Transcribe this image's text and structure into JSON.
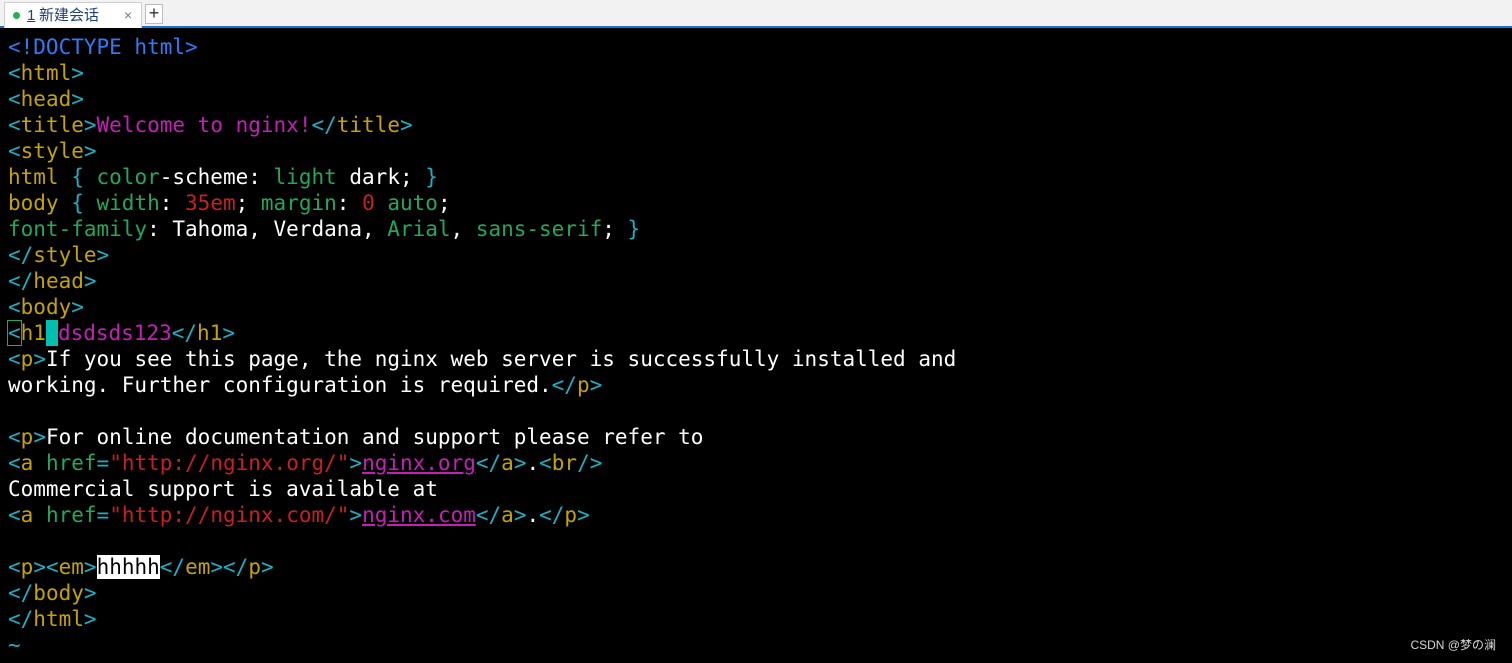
{
  "tab": {
    "number": "1",
    "title": "新建会话",
    "close_icon": "×",
    "new_tab_icon": "+",
    "status_color": "#22b14c"
  },
  "editor": {
    "lines": [
      [
        {
          "c": "b",
          "t": "<!DOCTYPE html>"
        }
      ],
      [
        {
          "c": "t",
          "t": "<"
        },
        {
          "c": "n",
          "t": "html"
        },
        {
          "c": "t",
          "t": ">"
        }
      ],
      [
        {
          "c": "t",
          "t": "<"
        },
        {
          "c": "n",
          "t": "head"
        },
        {
          "c": "t",
          "t": ">"
        }
      ],
      [
        {
          "c": "t",
          "t": "<"
        },
        {
          "c": "n",
          "t": "title"
        },
        {
          "c": "t",
          "t": ">"
        },
        {
          "c": "m",
          "t": "Welcome to nginx!"
        },
        {
          "c": "t",
          "t": "</"
        },
        {
          "c": "n",
          "t": "title"
        },
        {
          "c": "t",
          "t": ">"
        }
      ],
      [
        {
          "c": "t",
          "t": "<"
        },
        {
          "c": "n",
          "t": "style"
        },
        {
          "c": "t",
          "t": ">"
        }
      ],
      [
        {
          "c": "n",
          "t": "html "
        },
        {
          "c": "t",
          "t": "{ "
        },
        {
          "c": "k",
          "t": "color"
        },
        {
          "c": "w",
          "t": "-scheme: "
        },
        {
          "c": "k",
          "t": "light"
        },
        {
          "c": "w",
          "t": " dark; "
        },
        {
          "c": "t",
          "t": "}"
        }
      ],
      [
        {
          "c": "n",
          "t": "body "
        },
        {
          "c": "t",
          "t": "{ "
        },
        {
          "c": "k",
          "t": "width"
        },
        {
          "c": "w",
          "t": ": "
        },
        {
          "c": "v",
          "t": "35em"
        },
        {
          "c": "w",
          "t": "; "
        },
        {
          "c": "k",
          "t": "margin"
        },
        {
          "c": "w",
          "t": ": "
        },
        {
          "c": "v",
          "t": "0"
        },
        {
          "c": "w",
          "t": " "
        },
        {
          "c": "k",
          "t": "auto"
        },
        {
          "c": "w",
          "t": ";"
        }
      ],
      [
        {
          "c": "k",
          "t": "font-family"
        },
        {
          "c": "w",
          "t": ": Tahoma, Verdana, "
        },
        {
          "c": "k",
          "t": "Arial"
        },
        {
          "c": "w",
          "t": ", "
        },
        {
          "c": "k",
          "t": "sans-serif"
        },
        {
          "c": "w",
          "t": "; "
        },
        {
          "c": "t",
          "t": "}"
        }
      ],
      [
        {
          "c": "t",
          "t": "</"
        },
        {
          "c": "n",
          "t": "style"
        },
        {
          "c": "t",
          "t": ">"
        }
      ],
      [
        {
          "c": "t",
          "t": "</"
        },
        {
          "c": "n",
          "t": "head"
        },
        {
          "c": "t",
          "t": ">"
        }
      ],
      [
        {
          "c": "t",
          "t": "<"
        },
        {
          "c": "n",
          "t": "body"
        },
        {
          "c": "t",
          "t": ">"
        }
      ],
      [
        {
          "c": "t cursorbox",
          "t": "<"
        },
        {
          "c": "n",
          "t": "h1"
        },
        {
          "c": "cur",
          "t": " "
        },
        {
          "c": "m",
          "t": "dsdsds123"
        },
        {
          "c": "t",
          "t": "</"
        },
        {
          "c": "n",
          "t": "h1"
        },
        {
          "c": "t",
          "t": ">"
        }
      ],
      [
        {
          "c": "t",
          "t": "<"
        },
        {
          "c": "n",
          "t": "p"
        },
        {
          "c": "t",
          "t": ">"
        },
        {
          "c": "w",
          "t": "If you see this page, the nginx web server is successfully installed and"
        }
      ],
      [
        {
          "c": "w",
          "t": "working. Further configuration is required."
        },
        {
          "c": "t",
          "t": "</"
        },
        {
          "c": "n",
          "t": "p"
        },
        {
          "c": "t",
          "t": ">"
        }
      ],
      [],
      [
        {
          "c": "t",
          "t": "<"
        },
        {
          "c": "n",
          "t": "p"
        },
        {
          "c": "t",
          "t": ">"
        },
        {
          "c": "w",
          "t": "For online documentation and support please refer to"
        }
      ],
      [
        {
          "c": "t",
          "t": "<"
        },
        {
          "c": "n",
          "t": "a "
        },
        {
          "c": "k",
          "t": "href"
        },
        {
          "c": "t",
          "t": "="
        },
        {
          "c": "v",
          "t": "\"http://nginx.org/\""
        },
        {
          "c": "t",
          "t": ">"
        },
        {
          "c": "m u",
          "t": "nginx.org"
        },
        {
          "c": "t",
          "t": "</"
        },
        {
          "c": "n",
          "t": "a"
        },
        {
          "c": "t",
          "t": ">"
        },
        {
          "c": "w",
          "t": "."
        },
        {
          "c": "t",
          "t": "<"
        },
        {
          "c": "n",
          "t": "br"
        },
        {
          "c": "t",
          "t": "/>"
        }
      ],
      [
        {
          "c": "w",
          "t": "Commercial support is available at"
        }
      ],
      [
        {
          "c": "t",
          "t": "<"
        },
        {
          "c": "n",
          "t": "a "
        },
        {
          "c": "k",
          "t": "href"
        },
        {
          "c": "t",
          "t": "="
        },
        {
          "c": "v",
          "t": "\"http://nginx.com/\""
        },
        {
          "c": "t",
          "t": ">"
        },
        {
          "c": "m u",
          "t": "nginx.com"
        },
        {
          "c": "t",
          "t": "</"
        },
        {
          "c": "n",
          "t": "a"
        },
        {
          "c": "t",
          "t": ">"
        },
        {
          "c": "w",
          "t": "."
        },
        {
          "c": "t",
          "t": "</"
        },
        {
          "c": "n",
          "t": "p"
        },
        {
          "c": "t",
          "t": ">"
        }
      ],
      [],
      [
        {
          "c": "t",
          "t": "<"
        },
        {
          "c": "n",
          "t": "p"
        },
        {
          "c": "t",
          "t": "><"
        },
        {
          "c": "n",
          "t": "em"
        },
        {
          "c": "t",
          "t": ">"
        },
        {
          "c": "hl",
          "t": "hhhhh"
        },
        {
          "c": "t",
          "t": "</"
        },
        {
          "c": "n",
          "t": "em"
        },
        {
          "c": "t",
          "t": "></"
        },
        {
          "c": "n",
          "t": "p"
        },
        {
          "c": "t",
          "t": ">"
        }
      ],
      [
        {
          "c": "t",
          "t": "</"
        },
        {
          "c": "n",
          "t": "body"
        },
        {
          "c": "t",
          "t": ">"
        }
      ],
      [
        {
          "c": "t",
          "t": "</"
        },
        {
          "c": "n",
          "t": "html"
        },
        {
          "c": "t",
          "t": ">"
        }
      ],
      [
        {
          "c": "t",
          "t": "~"
        }
      ]
    ]
  },
  "watermark": "CSDN @梦の澜"
}
